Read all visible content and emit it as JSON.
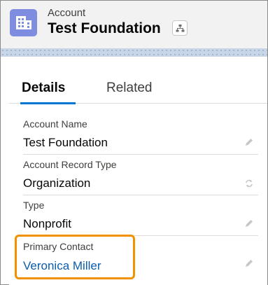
{
  "header": {
    "object_label": "Account",
    "record_name": "Test Foundation"
  },
  "tabs": [
    {
      "label": "Details",
      "active": true
    },
    {
      "label": "Related",
      "active": false
    }
  ],
  "fields": [
    {
      "label": "Account Name",
      "value": "Test Foundation"
    },
    {
      "label": "Account Record Type",
      "value": "Organization"
    },
    {
      "label": "Type",
      "value": "Nonprofit"
    },
    {
      "label": "Primary Contact",
      "value": "Veronica Miller"
    }
  ],
  "colors": {
    "object_icon": "#7f8de1",
    "tab_active": "#0176d3",
    "link": "#0b5cab",
    "highlight": "#f29100"
  }
}
